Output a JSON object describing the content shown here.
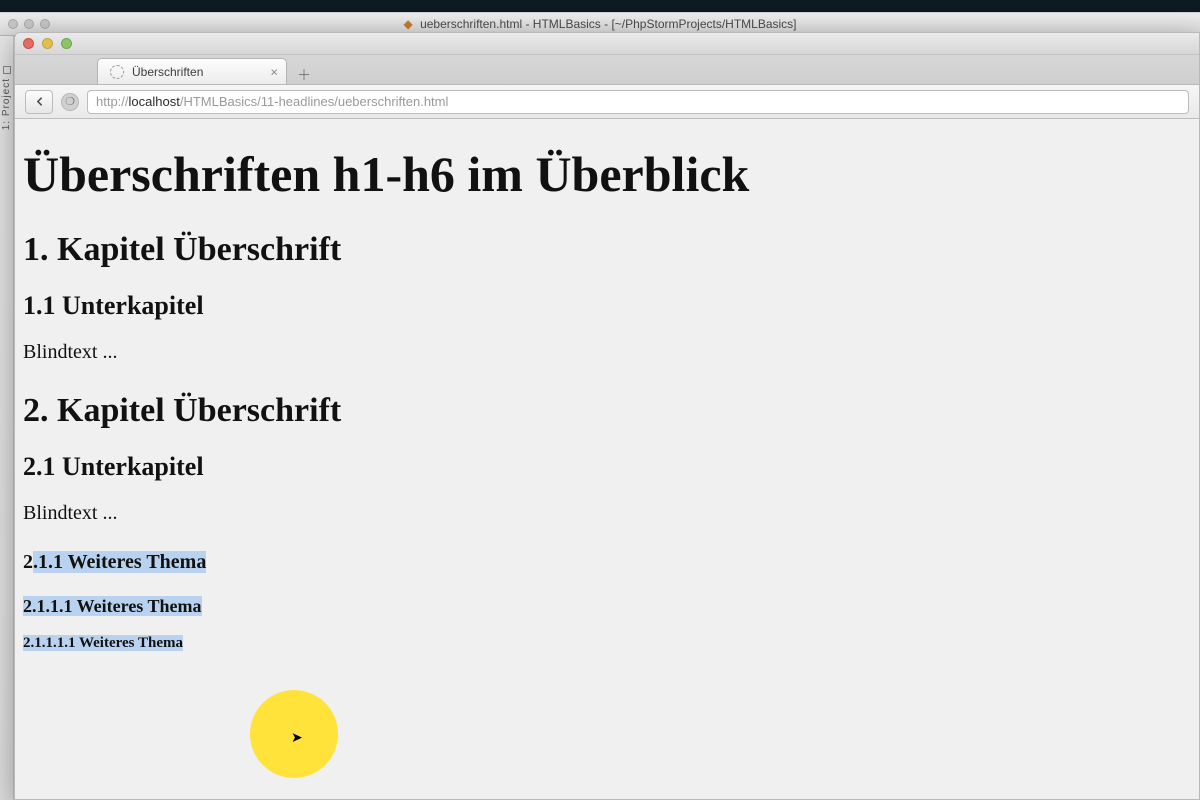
{
  "ide": {
    "title": "ueberschriften.html - HTMLBasics - [~/PhpStormProjects/HTMLBasics]",
    "sidebar_label": "1: Project"
  },
  "browser": {
    "tab_title": "Überschriften",
    "url_scheme": "http://",
    "url_host": "localhost",
    "url_path": "/HTMLBasics/11-headlines/ueberschriften.html"
  },
  "doc": {
    "h1": "Überschriften h1-h6 im Überblick",
    "h2_a": "1. Kapitel Überschrift",
    "h3_a": "1.1 Unterkapitel",
    "p_a": "Blindtext ...",
    "h2_b": "2. Kapitel Überschrift",
    "h3_b": "2.1 Unterkapitel",
    "p_b": "Blindtext ...",
    "h4_prefix": "2",
    "h4_rest": ".1.1 Weiteres Thema",
    "h5": "2.1.1.1 Weiteres Thema",
    "h6": "2.1.1.1.1 Weiteres Thema"
  }
}
